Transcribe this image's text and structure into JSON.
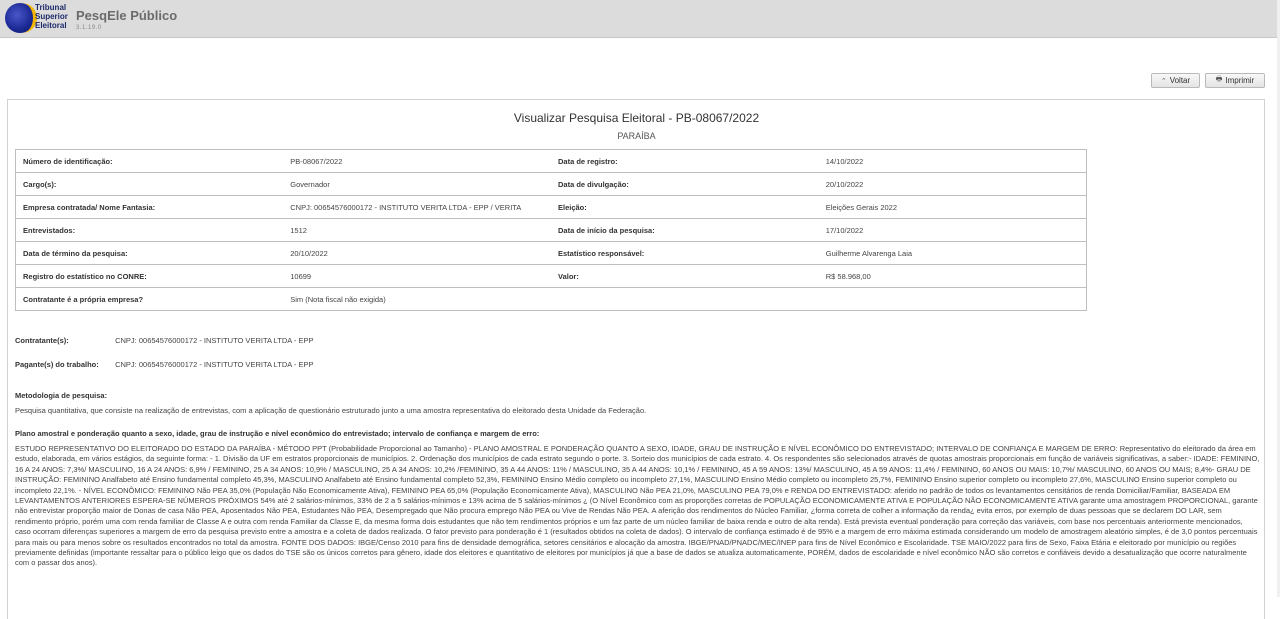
{
  "header": {
    "logo_lines": [
      "Tribunal",
      "Superior",
      "Eleitoral"
    ],
    "app_title": "PesqEle Público",
    "version": "3.1.19.0"
  },
  "toolbar": {
    "back_label": "Voltar",
    "print_label": "Imprimir"
  },
  "page": {
    "title": "Visualizar Pesquisa Eleitoral - PB-08067/2022",
    "subtitle": "PARAÍBA"
  },
  "info_rows": [
    {
      "l1": "Número de identificação:",
      "v1": "PB-08067/2022",
      "l2": "Data de registro:",
      "v2": "14/10/2022"
    },
    {
      "l1": "Cargo(s):",
      "v1": "Governador",
      "l2": "Data de divulgação:",
      "v2": "20/10/2022"
    },
    {
      "l1": "Empresa contratada/ Nome Fantasia:",
      "v1": "CNPJ: 00654576000172 - INSTITUTO VERITA LTDA - EPP / VERITA",
      "l2": "Eleição:",
      "v2": "Eleições Gerais 2022"
    },
    {
      "l1": "Entrevistados:",
      "v1": "1512",
      "l2": "Data de início da pesquisa:",
      "v2": "17/10/2022"
    },
    {
      "l1": "Data de término da pesquisa:",
      "v1": "20/10/2022",
      "l2": "Estatístico responsável:",
      "v2": "Guilherme Alvarenga Laia"
    },
    {
      "l1": "Registro do estatístico no CONRE:",
      "v1": "10699",
      "l2": "Valor:",
      "v2": "R$ 58.968,00"
    },
    {
      "l1": "Contratante é a própria empresa?",
      "v1": "Sim (Nota fiscal não exigida)",
      "l2": "",
      "v2": ""
    }
  ],
  "contratante": {
    "label": "Contratante(s):",
    "value": "CNPJ: 00654576000172 - INSTITUTO VERITA LTDA - EPP"
  },
  "pagante": {
    "label": "Pagante(s) do trabalho:",
    "value": "CNPJ: 00654576000172 - INSTITUTO VERITA LTDA - EPP"
  },
  "metodologia": {
    "title": "Metodologia de pesquisa:",
    "text": "Pesquisa quantitativa, que consiste na realização de entrevistas, com a aplicação de questionário estruturado junto a uma amostra representativa do eleitorado desta Unidade da Federação."
  },
  "plano": {
    "title": "Plano amostral e ponderação quanto a sexo, idade, grau de instrução e nível econômico do entrevistado; intervalo de confiança e margem de erro:",
    "text": "ESTUDO REPRESENTATIVO DO ELEITORADO DO ESTADO DA PARAÍBA - MÉTODO PPT (Probabilidade Proporcional ao Tamanho) - PLANO AMOSTRAL E PONDERAÇÃO QUANTO A SEXO, IDADE, GRAU DE INSTRUÇÃO E NÍVEL ECONÔMICO DO ENTREVISTADO; INTERVALO DE CONFIANÇA E MARGEM DE ERRO: Representativo do eleitorado da área em estudo, elaborada, em vários estágios, da seguinte forma: - 1. Divisão da UF em estratos proporcionais de municípios. 2. Ordenação dos municípios de cada estrato segundo o porte. 3. Sorteio dos municípios de cada estrato. 4. Os respondentes são selecionados através de quotas amostrais proporcionais em função de variáveis significativas, a saber:- IDADE: FEMININO, 16 A 24 ANOS: 7,3%/ MASCULINO, 16 A 24 ANOS: 6,9% / FEMININO, 25 A 34 ANOS: 10,9% / MASCULINO, 25 A 34 ANOS: 10,2% /FEMININO, 35 A 44 ANOS: 11% / MASCULINO, 35 A 44 ANOS: 10,1% / FEMININO, 45 A 59 ANOS: 13%/ MASCULINO, 45 A 59 ANOS: 11,4% / FEMININO, 60 ANOS OU MAIS: 10,7%/ MASCULINO, 60 ANOS OU MAIS; 8,4%- GRAU DE INSTRUÇÃO: FEMININO Analfabeto até Ensino fundamental completo 45,3%, MASCULINO Analfabeto até Ensino fundamental completo 52,3%, FEMININO Ensino Médio completo ou incompleto 27,1%, MASCULINO Ensino Médio completo ou incompleto 25,7%, FEMININO Ensino superior completo ou incompleto 27,6%, MASCULINO Ensino superior completo ou incompleto 22,1%. - NÍVEL ECONÔMICO: FEMININO Não PEA 35,0% (População Não Economicamente Ativa), FEMININO PEA 65,0% (População Economicamente Ativa), MASCULINO Não PEA 21,0%, MASCULINO PEA 79,0% e RENDA DO ENTREVISTADO: aferido no padrão de todos os levantamentos censitários de renda Domiciliar/Familiar, BASEADA EM LEVANTAMENTOS ANTERIORES ESPERA-SE NÚMEROS PRÓXIMOS 54% até 2 salários-mínimos, 33% de 2 a 5 salários-mínimos e 13% acima de 5 salários-mínimos ¿ (O Nível Econômico com as proporções corretas de POPULAÇÃO ECONOMICAMENTE ATIVA E POPULAÇÃO NÃO ECONOMICAMENTE ATIVA garante uma amostragem PROPORCIONAL, garante não entrevistar proporção maior de Donas de casa Não PEA, Aposentados Não PEA, Estudantes Não PEA, Desempregado que Não procura emprego Não PEA ou Vive de Rendas Não PEA. A aferição dos rendimentos do Núcleo Familiar, ¿forma correta de colher a informação da renda¿ evita erros, por exemplo de duas pessoas que se declarem DO LAR, sem rendimento próprio, porém uma com renda familiar de Classe A e outra com renda Familiar da Classe E, da mesma forma dois estudantes que não tem rendimentos próprios e um faz parte de um núcleo familiar de baixa renda e outro de alta renda). Está prevista eventual ponderação para correção das variáveis, com base nos percentuais anteriormente mencionados, caso ocorram diferenças superiores a margem de erro da pesquisa previsto entre a amostra e a coleta de dados realizada. O fator previsto para ponderação é 1 (resultados obtidos na coleta de dados). O intervalo de confiança estimado é de 95% e a margem de erro máxima estimada considerando um modelo de amostragem aleatório simples, é de 3,0 pontos percentuais para mais ou para menos sobre os resultados encontrados no total da amostra. FONTE DOS DADOS: IBGE/Censo 2010 para fins de densidade demográfica, setores censitários e alocação da amostra. IBGE/PNAD/PNADC/MEC/INEP para fins de Nível Econômico e Escolaridade. TSE MAIO/2022 para fins de Sexo, Faixa Etária e eleitorado por município ou regiões previamente definidas (importante ressaltar para o público leigo que os dados do TSE são os únicos corretos para gênero, idade dos eleitores e quantitativo de eleitores por municípios já que a base de dados se atualiza automaticamente, PORÉM, dados de escolaridade e nível econômico NÃO são corretos e confiáveis devido a desatualização que ocorre naturalmente com o passar dos anos)."
  }
}
